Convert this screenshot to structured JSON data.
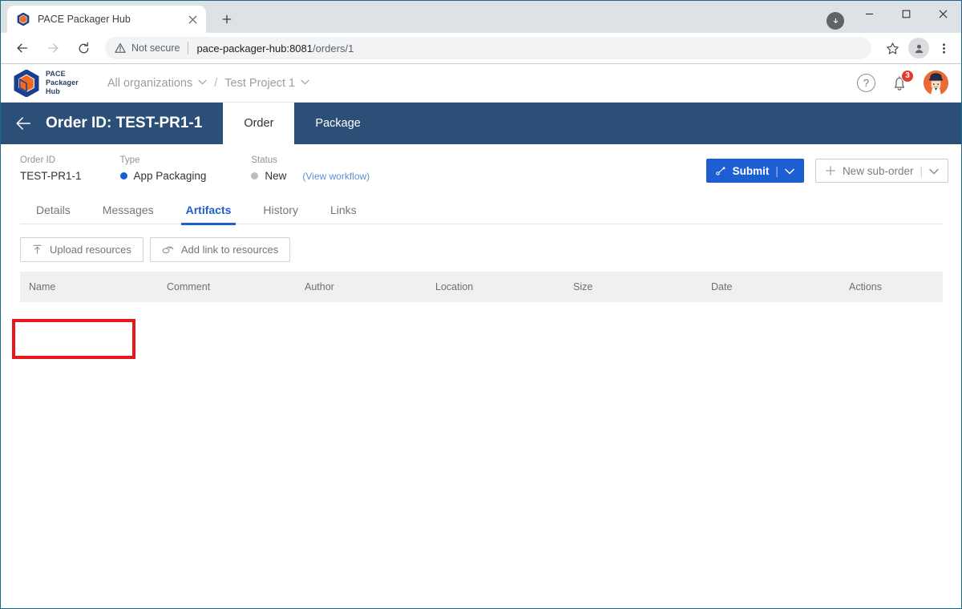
{
  "browser": {
    "tab": {
      "title": "PACE Packager Hub",
      "favicon_icon": "pace-cube-icon",
      "close_icon": "close-icon"
    },
    "new_tab_icon": "plus-icon",
    "window_controls": {
      "minimize_icon": "minimize-icon",
      "maximize_icon": "maximize-icon",
      "close_icon": "window-close-icon"
    },
    "download_chip_icon": "download-icon",
    "toolbar": {
      "back_icon": "arrow-left-icon",
      "forward_icon": "arrow-right-icon",
      "reload_icon": "reload-icon",
      "security_icon": "warning-triangle-icon",
      "security_label": "Not secure",
      "url_host": "pace-packager-hub:8081",
      "url_path": "/orders/1",
      "bookmark_icon": "star-icon",
      "profile_icon": "account-icon",
      "menu_icon": "three-dots-icon"
    }
  },
  "app_header": {
    "logo_icon": "pace-cube-logo",
    "brand_line1": "PACE",
    "brand_line2": "Packager",
    "brand_line3": "Hub",
    "breadcrumb": {
      "organization": "All organizations",
      "separator": "/",
      "project": "Test Project 1",
      "caret_icon": "chevron-down-icon"
    },
    "help_icon": "question-mark-icon",
    "help_label": "?",
    "notifications_icon": "bell-icon",
    "notifications_count": "3",
    "avatar_icon": "user-avatar"
  },
  "order_bar": {
    "back_icon": "arrow-left-icon",
    "title": "Order ID: TEST-PR1-1",
    "tabs": [
      {
        "label": "Order",
        "active": true
      },
      {
        "label": "Package",
        "active": false
      }
    ]
  },
  "meta": {
    "order_id_label": "Order ID",
    "order_id_value": "TEST-PR1-1",
    "type_label": "Type",
    "type_value": "App Packaging",
    "type_dot_color": "#1d5ed3",
    "status_label": "Status",
    "status_value": "New",
    "status_dot_color": "#b9bec4",
    "workflow_link": "(View workflow)"
  },
  "actions": {
    "submit_label": "Submit",
    "submit_icon": "workflow-branch-icon",
    "submit_caret_icon": "chevron-down-icon",
    "submit_separator": "|",
    "new_suborder_label": "New sub-order",
    "new_suborder_icon": "plus-icon",
    "new_suborder_caret_icon": "chevron-down-icon",
    "new_suborder_separator": "|"
  },
  "sub_tabs": [
    {
      "label": "Details",
      "active": false
    },
    {
      "label": "Messages",
      "active": false
    },
    {
      "label": "Artifacts",
      "active": true
    },
    {
      "label": "History",
      "active": false
    },
    {
      "label": "Links",
      "active": false
    }
  ],
  "artifact_toolbar": [
    {
      "label": "Upload resources",
      "icon": "upload-arrow-icon",
      "highlighted": true
    },
    {
      "label": "Add link to resources",
      "icon": "link-chain-icon",
      "highlighted": false
    }
  ],
  "artifact_table": {
    "columns": [
      "Name",
      "Comment",
      "Author",
      "Location",
      "Size",
      "Date",
      "Actions"
    ],
    "rows": []
  },
  "colors": {
    "order_bar_bg": "#2c4f77",
    "accent_blue": "#1d5ed3",
    "highlight_red": "#e8161d",
    "brand_orange": "#ea6a33",
    "table_header_bg": "#f0f0f0"
  }
}
